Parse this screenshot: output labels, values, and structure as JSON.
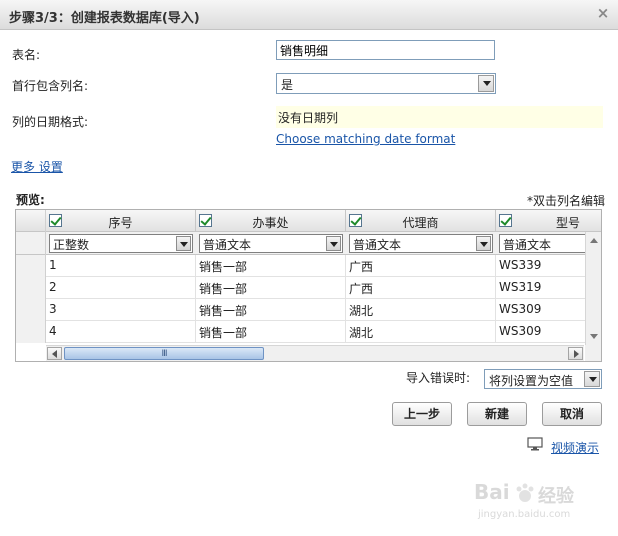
{
  "dialog": {
    "title": "步骤3/3：创建报表数据库(导入)",
    "close_glyph": "×"
  },
  "form": {
    "table_name_label": "表名:",
    "table_name_value": "销售明细",
    "first_row_label": "首行包含列名:",
    "first_row_value": "是",
    "date_format_label": "列的日期格式:",
    "date_format_value": "没有日期列",
    "date_format_link": "Choose matching date format",
    "more_settings": "更多 设置"
  },
  "preview": {
    "title": "预览:",
    "hint": "*双击列名编辑",
    "columns": [
      {
        "name": "序号",
        "type": "正整数"
      },
      {
        "name": "办事处",
        "type": "普通文本"
      },
      {
        "name": "代理商",
        "type": "普通文本"
      },
      {
        "name": "型号",
        "type": "普通文本"
      }
    ],
    "rows": [
      [
        "1",
        "销售一部",
        "广西",
        "WS339"
      ],
      [
        "2",
        "销售一部",
        "广西",
        "WS319"
      ],
      [
        "3",
        "销售一部",
        "湖北",
        "WS309"
      ],
      [
        "4",
        "销售一部",
        "湖北",
        "WS309"
      ]
    ],
    "scroll_thumb_glyph": "III"
  },
  "import_error": {
    "label": "导入错误时:",
    "value": "将列设置为空值"
  },
  "buttons": {
    "prev": "上一步",
    "create": "新建",
    "cancel": "取消"
  },
  "video_link": "视频演示",
  "watermark": {
    "line1": "Bai",
    "line2": "经验",
    "line3": "jingyan.baidu.com"
  },
  "colors": {
    "link": "#1a55a8",
    "date_bg": "#ffffe6",
    "check": "#1e8a2a"
  }
}
